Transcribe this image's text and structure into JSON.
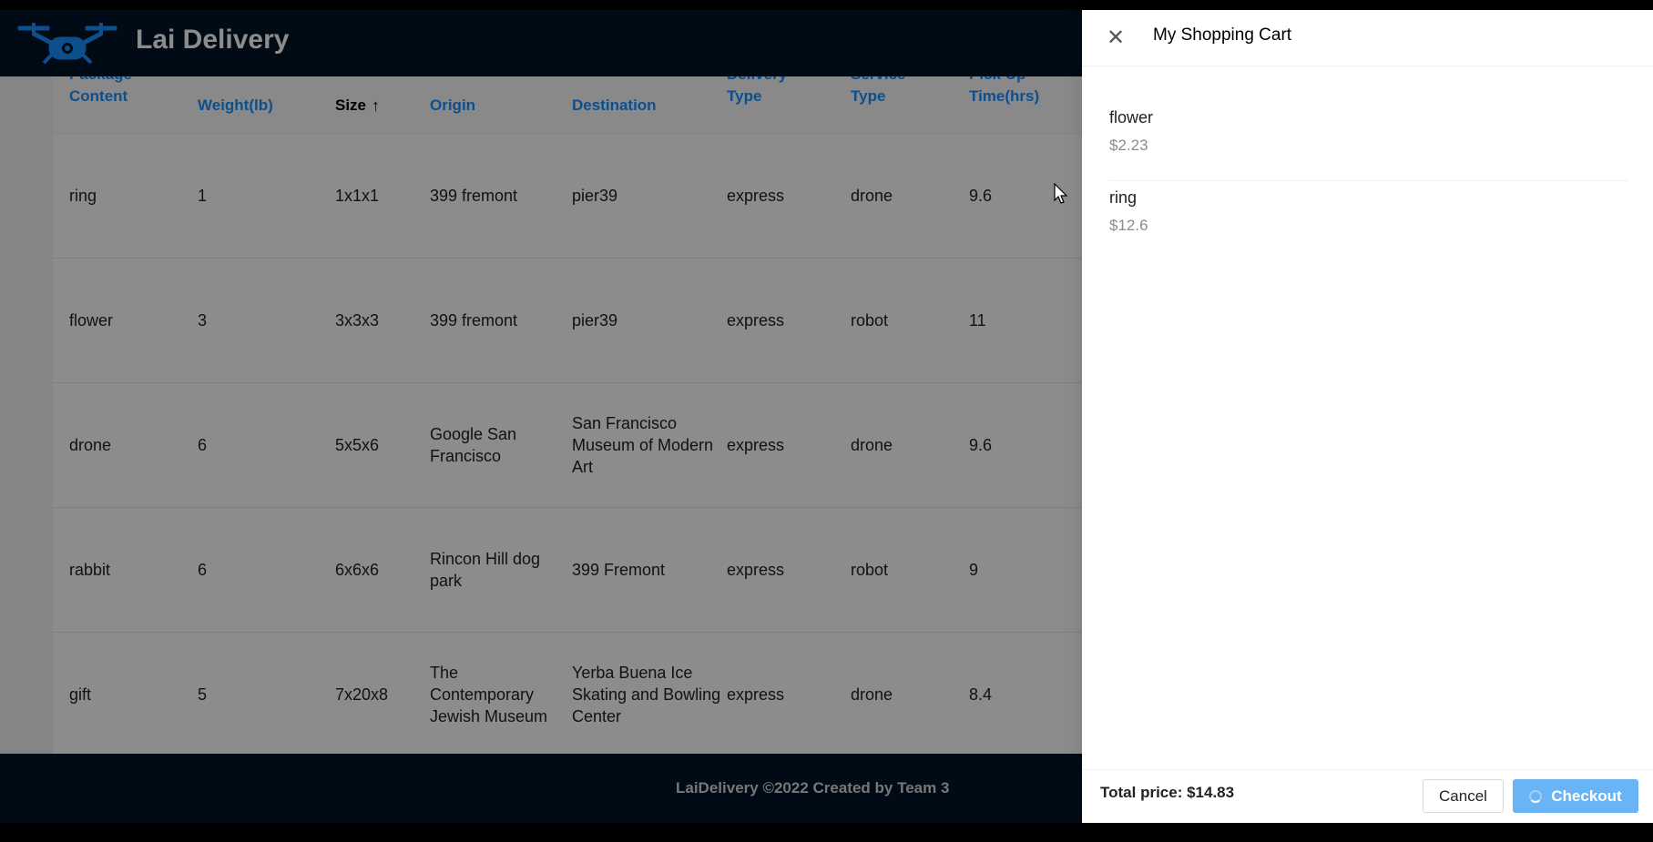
{
  "app": {
    "brand": "Lai Delivery"
  },
  "table": {
    "columns": [
      {
        "label_line1": "Package",
        "label_line2": "Content",
        "cut": true
      },
      {
        "label_line1": "Weight(lb)",
        "label_line2": "",
        "cut": false
      },
      {
        "label_line1": "Size",
        "label_line2": "",
        "cut": false,
        "sort": "ascending",
        "active": true
      },
      {
        "label_line1": "Origin",
        "label_line2": "",
        "cut": false
      },
      {
        "label_line1": "Destination",
        "label_line2": "",
        "cut": false
      },
      {
        "label_line1": "Delivery",
        "label_line2": "Type",
        "cut": true
      },
      {
        "label_line1": "Service",
        "label_line2": "Type",
        "cut": true
      },
      {
        "label_line1": "Pick Up",
        "label_line2": "Time(hrs)",
        "cut": true
      }
    ],
    "rows": [
      {
        "cells": [
          "ring",
          "1",
          "1x1x1",
          "399 fremont",
          "pier39",
          "express",
          "drone",
          "9.6"
        ]
      },
      {
        "cells": [
          "flower",
          "3",
          "3x3x3",
          "399 fremont",
          "pier39",
          "express",
          "robot",
          "11"
        ]
      },
      {
        "cells": [
          "drone",
          "6",
          "5x5x6",
          "Google San Francisco",
          "San Francisco Museum of Modern Art",
          "express",
          "drone",
          "9.6"
        ]
      },
      {
        "cells": [
          "rabbit",
          "6",
          "6x6x6",
          "Rincon Hill dog park",
          "399 Fremont",
          "express",
          "robot",
          "9"
        ]
      },
      {
        "cells": [
          "gift",
          "5",
          "7x20x8",
          "The Contemporary Jewish Museum",
          "Yerba Buena Ice Skating and Bowling Center",
          "express",
          "drone",
          "8.4"
        ]
      }
    ]
  },
  "footer": {
    "text": "LaiDelivery ©2022 Created by Team 3"
  },
  "cart": {
    "title": "My Shopping Cart",
    "items": [
      {
        "name": "flower",
        "price": "$2.23"
      },
      {
        "name": "ring",
        "price": "$12.6"
      }
    ],
    "total": "Total price: $14.83",
    "cancel_label": "Cancel",
    "checkout_label": "Checkout"
  },
  "icons": {
    "logo": "drone-logo-icon",
    "sort": "arrow-up-icon",
    "close": "close-icon",
    "loading": "loading-spinner-icon",
    "cursor": "mouse-cursor-icon"
  },
  "colors": {
    "header_bg": "#001529",
    "link": "#1890ff",
    "checkout_bg": "#69b4f4",
    "logo": "#1890ff"
  }
}
